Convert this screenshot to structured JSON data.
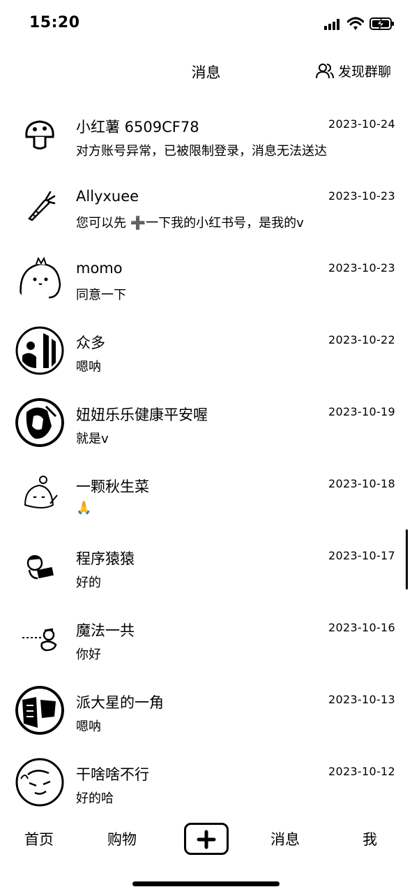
{
  "status_bar": {
    "time": "15:20"
  },
  "header": {
    "title": "消息",
    "discover_label": "发现群聊"
  },
  "chats": [
    {
      "name": "小红薯 6509CF78",
      "date": "2023-10-24",
      "preview": "对方账号异常，已被限制登录，消息无法送达",
      "avatar": "mushroom-icon"
    },
    {
      "name": "Allyxuee",
      "date": "2023-10-23",
      "preview": "您可以先 ➕一下我的小红书号，是我的v",
      "avatar": "carrot-icon"
    },
    {
      "name": "momo",
      "date": "2023-10-23",
      "preview": "同意一下",
      "avatar": "dino-icon"
    },
    {
      "name": "众多",
      "date": "2023-10-22",
      "preview": "嗯呐",
      "avatar": "photo-avatar"
    },
    {
      "name": "妞妞乐乐健康平安喔",
      "date": "2023-10-19",
      "preview": "就是v",
      "avatar": "photo-avatar"
    },
    {
      "name": "一颗秋生菜",
      "date": "2023-10-18",
      "preview": "🙏",
      "avatar": "doodle-avatar"
    },
    {
      "name": "程序猿猿",
      "date": "2023-10-17",
      "preview": "好的",
      "avatar": "cartoon-avatar"
    },
    {
      "name": "魔法一共",
      "date": "2023-10-16",
      "preview": "你好",
      "avatar": "cartoon-avatar"
    },
    {
      "name": "派大星的一角",
      "date": "2023-10-13",
      "preview": "嗯呐",
      "avatar": "photo-avatar"
    },
    {
      "name": "干啥啥不行",
      "date": "2023-10-12",
      "preview": "好的哈",
      "avatar": "photo-avatar"
    }
  ],
  "tab_bar": {
    "home": "首页",
    "shop": "购物",
    "messages": "消息",
    "me": "我"
  }
}
